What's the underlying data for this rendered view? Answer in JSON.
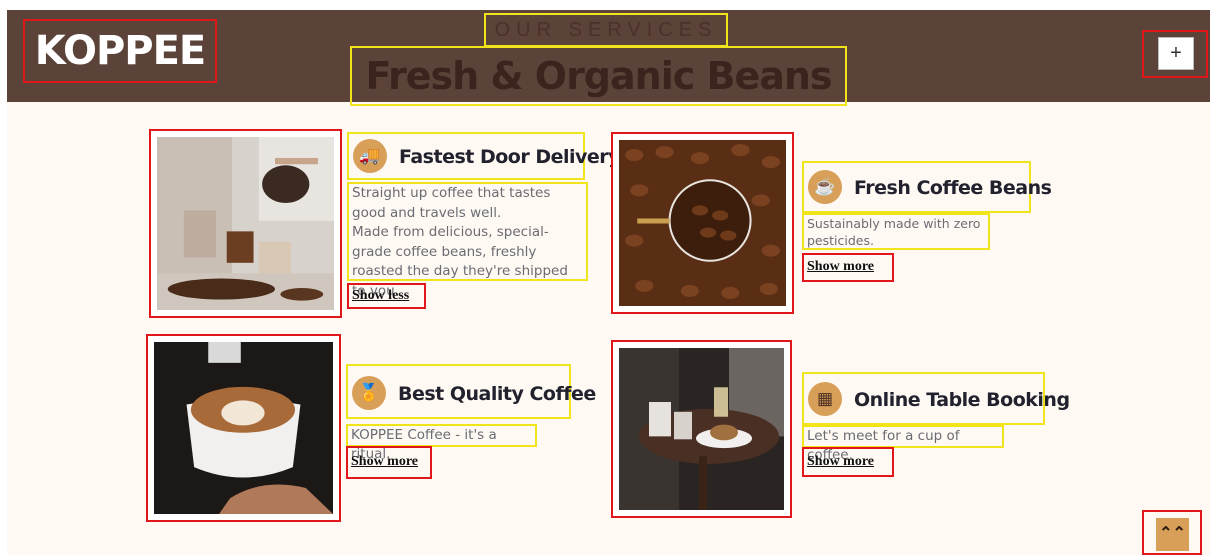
{
  "header": {
    "brand": "KOPPEE",
    "kicker": "OUR SERVICES",
    "title": "Fresh & Organic Beans",
    "plus_label": "+"
  },
  "services": [
    {
      "title": "Fastest Door Delivery",
      "icon": "truck-icon",
      "icon_glyph": "🚚",
      "desc_lines": [
        "Straight up coffee that tastes good and travels well.",
        "Made from delicious, special-grade coffee beans, freshly roasted the day they're shipped to you."
      ],
      "toggle": "Show less"
    },
    {
      "title": "Fresh Coffee Beans",
      "icon": "coffee-cup-icon",
      "icon_glyph": "☕",
      "desc_lines": [
        "Sustainably made with zero pesticides."
      ],
      "toggle": "Show more"
    },
    {
      "title": "Best Quality Coffee",
      "icon": "award-icon",
      "icon_glyph": "🏅",
      "desc_lines": [
        "KOPPEE Coffee - it's a ritual."
      ],
      "toggle": "Show more"
    },
    {
      "title": "Online Table Booking",
      "icon": "table-icon",
      "icon_glyph": "▦",
      "desc_lines": [
        "Let's meet for a cup of coffee."
      ],
      "toggle": "Show more"
    }
  ],
  "back_to_top": {
    "icon": "double-chevron-up-icon",
    "glyph": "⌃⌃"
  },
  "colors": {
    "header_bg": "#5c4339",
    "page_bg": "#fff9f4",
    "accent": "#d89f59"
  }
}
